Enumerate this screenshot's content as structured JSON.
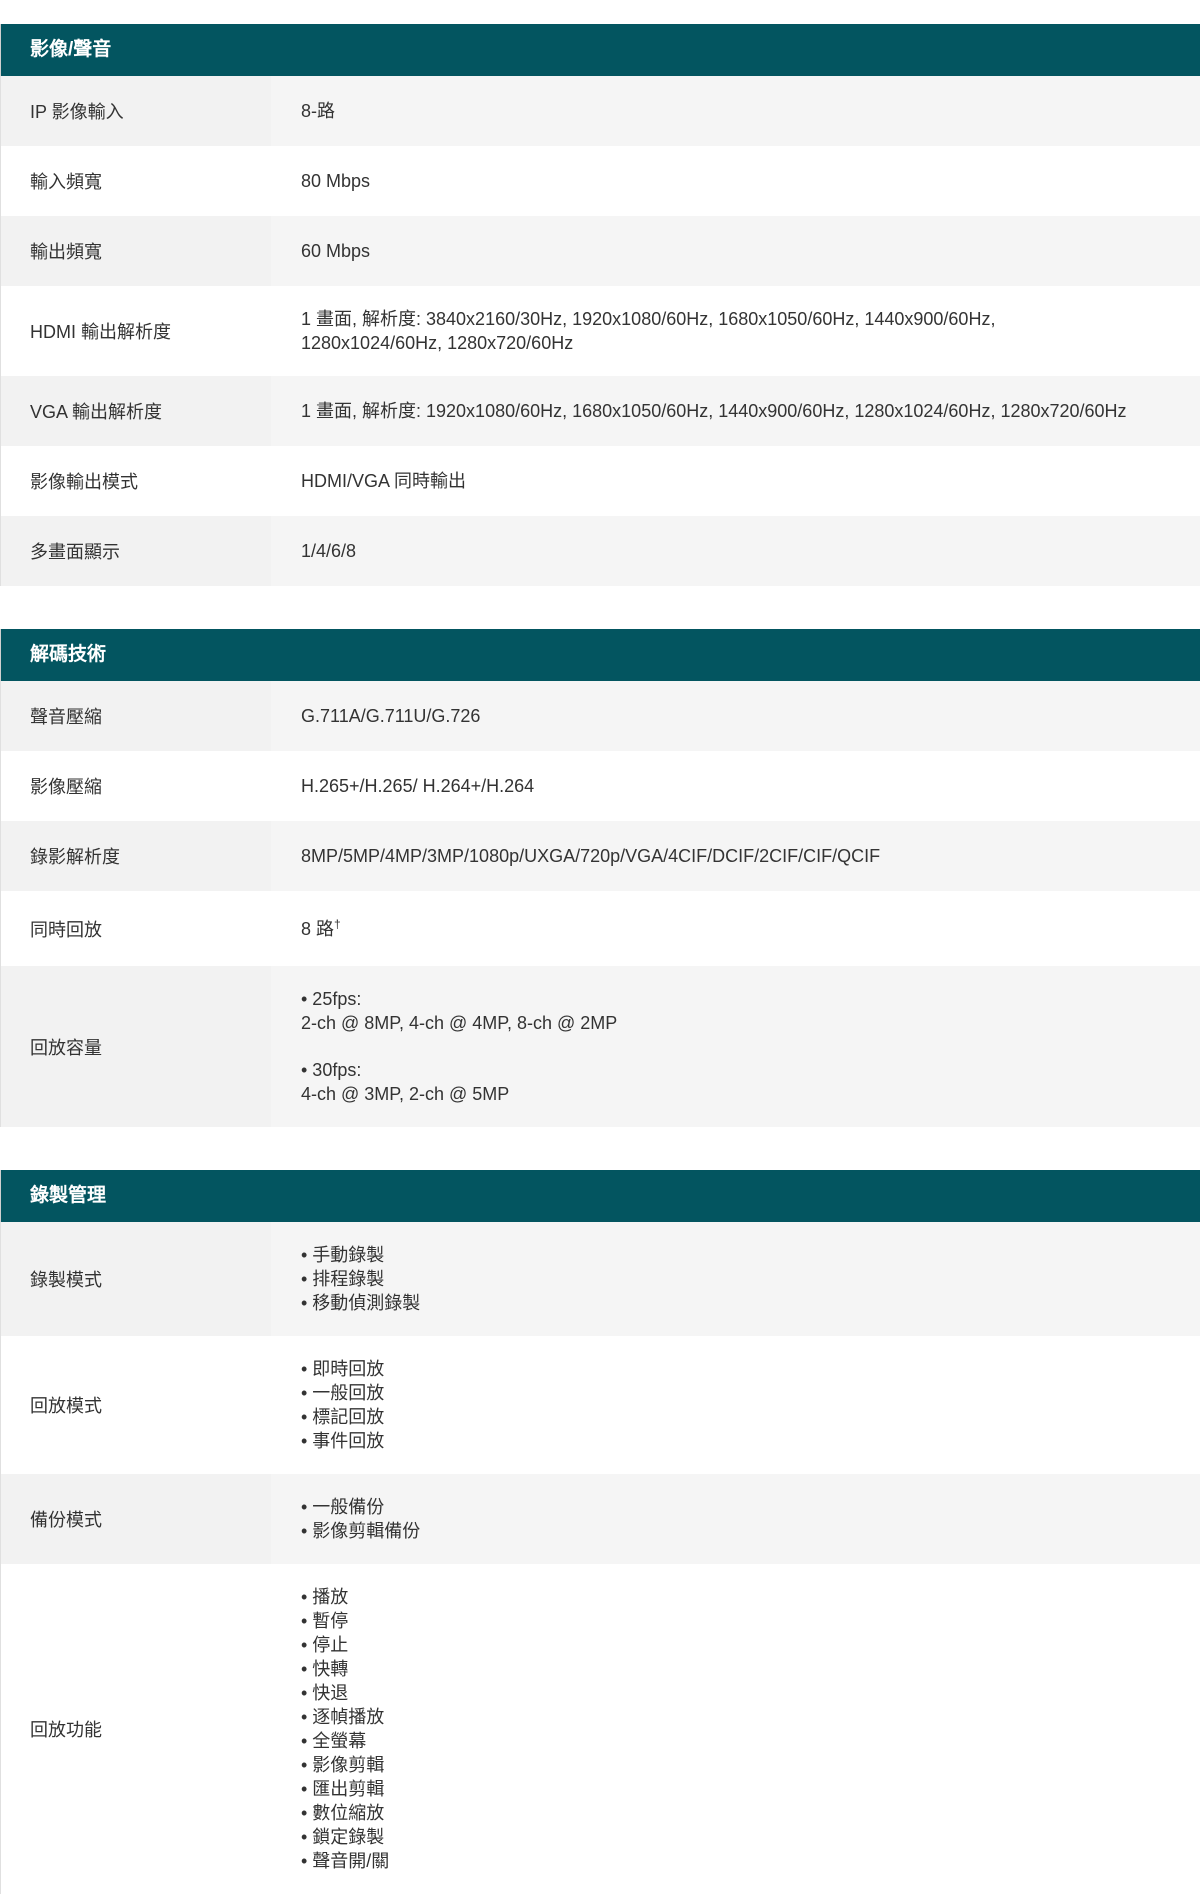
{
  "sections": [
    {
      "title": "影像/聲音",
      "rows": [
        {
          "label": "IP 影像輸入",
          "value": "8-路"
        },
        {
          "label": "輸入頻寬",
          "value": "80 Mbps"
        },
        {
          "label": "輸出頻寬",
          "value": "60 Mbps"
        },
        {
          "label": "HDMI 輸出解析度",
          "lines": [
            "1 畫面, 解析度: 3840x2160/30Hz, 1920x1080/60Hz, 1680x1050/60Hz, 1440x900/60Hz,",
            "1280x1024/60Hz, 1280x720/60Hz"
          ]
        },
        {
          "label": "VGA 輸出解析度",
          "value": "1 畫面, 解析度: 1920x1080/60Hz, 1680x1050/60Hz, 1440x900/60Hz, 1280x1024/60Hz, 1280x720/60Hz"
        },
        {
          "label": "影像輸出模式",
          "value": "HDMI/VGA 同時輸出"
        },
        {
          "label": "多畫面顯示",
          "value": "1/4/6/8"
        }
      ]
    },
    {
      "title": "解碼技術",
      "rows": [
        {
          "label": "聲音壓縮",
          "value": "G.711A/G.711U/G.726"
        },
        {
          "label": "影像壓縮",
          "value": "H.265+/H.265/ H.264+/H.264"
        },
        {
          "label": "錄影解析度",
          "value": "8MP/5MP/4MP/3MP/1080p/UXGA/720p/VGA/4CIF/DCIF/2CIF/CIF/QCIF"
        },
        {
          "label": "同時回放",
          "value": "8 路",
          "sup": "†"
        },
        {
          "label": "回放容量",
          "blocks": [
            [
              "• 25fps:",
              "2-ch @ 8MP, 4-ch @ 4MP, 8-ch @ 2MP"
            ],
            [
              "• 30fps:",
              "4-ch @ 3MP, 2-ch @ 5MP"
            ]
          ]
        }
      ]
    },
    {
      "title": "錄製管理",
      "rows": [
        {
          "label": "錄製模式",
          "lines": [
            "• 手動錄製",
            "• 排程錄製",
            "• 移動偵測錄製"
          ]
        },
        {
          "label": "回放模式",
          "lines": [
            "• 即時回放",
            "• 一般回放",
            "• 標記回放",
            "• 事件回放"
          ]
        },
        {
          "label": "備份模式",
          "lines": [
            "• 一般備份",
            "• 影像剪輯備份"
          ]
        },
        {
          "label": "回放功能",
          "lines": [
            "• 播放",
            "• 暫停",
            "• 停止",
            "• 快轉",
            "• 快退",
            "• 逐幀播放",
            "• 全螢幕",
            "• 影像剪輯",
            "• 匯出剪輯",
            "• 數位縮放",
            "• 鎖定錄製",
            "• 聲音開/關"
          ]
        }
      ]
    }
  ]
}
